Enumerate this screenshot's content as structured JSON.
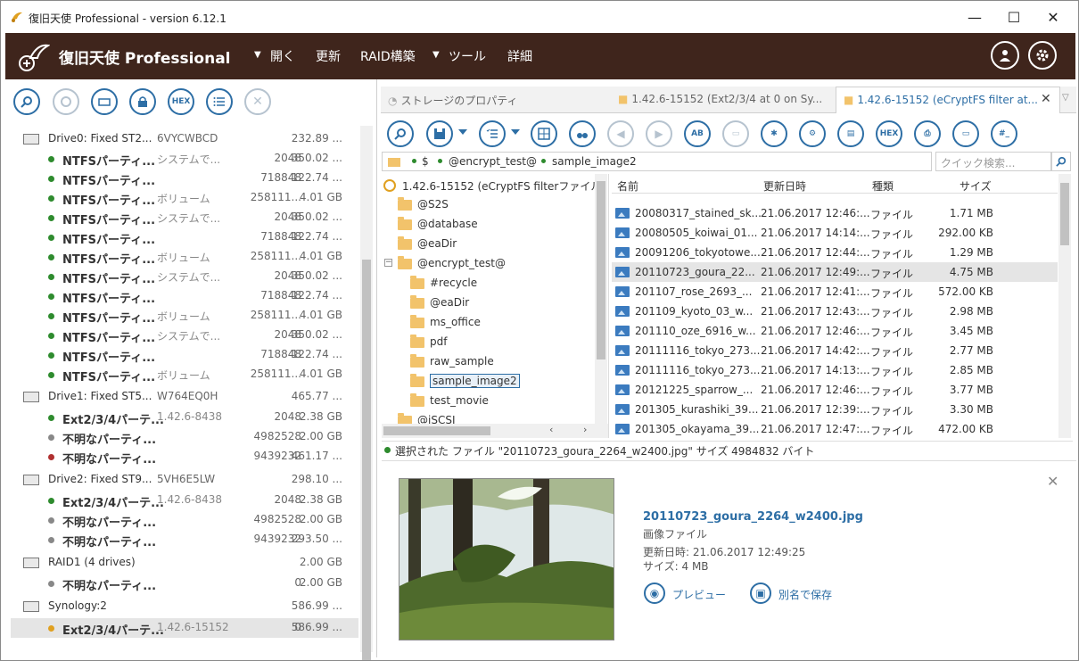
{
  "window": {
    "title": "復旧天使 Professional - version 6.12.1",
    "minimize": "—",
    "maximize": "☐",
    "close": "✕"
  },
  "menubar": {
    "brand": "復旧天使 Professional",
    "items": [
      "開く",
      "更新",
      "RAID構築",
      "ツール",
      "詳細"
    ],
    "accent": "#3f251c"
  },
  "left_toolbar": {
    "hex_label": "HEX"
  },
  "drives": [
    {
      "name": "Drive0: Fixed ST2...",
      "serial": "6VYCWBCD",
      "size": "232.89 ..."
    },
    {
      "name": "Drive1: Fixed ST5...",
      "serial": "W764EQ0H",
      "size": "465.77 ..."
    },
    {
      "name": "Drive2: Fixed ST9...",
      "serial": "5VH6E5LW",
      "size": "298.10 ..."
    },
    {
      "name": "RAID1 (4 drives)",
      "serial": "",
      "size": "2.00 GB"
    },
    {
      "name": "Synology:2",
      "serial": "",
      "size": "586.99 ..."
    }
  ],
  "partitions": [
    {
      "name": "NTFSパーティ...",
      "label": "システムで...",
      "start": "2048",
      "size": "350.02 ...",
      "color": "#2e8b2e"
    },
    {
      "name": "NTFSパーティ...",
      "label": "",
      "start": "718848",
      "size": "122.74 ...",
      "color": "#2e8b2e"
    },
    {
      "name": "NTFSパーティ...",
      "label": "ボリューム",
      "start": "258111...",
      "size": "4.01 GB",
      "color": "#2e8b2e"
    },
    {
      "name": "NTFSパーティ...",
      "label": "システムで...",
      "start": "2048",
      "size": "350.02 ...",
      "color": "#2e8b2e"
    },
    {
      "name": "NTFSパーティ...",
      "label": "",
      "start": "718848",
      "size": "122.74 ...",
      "color": "#2e8b2e"
    },
    {
      "name": "NTFSパーティ...",
      "label": "ボリューム",
      "start": "258111...",
      "size": "4.01 GB",
      "color": "#2e8b2e"
    },
    {
      "name": "NTFSパーティ...",
      "label": "システムで...",
      "start": "2048",
      "size": "350.02 ...",
      "color": "#2e8b2e"
    },
    {
      "name": "NTFSパーティ...",
      "label": "",
      "start": "718848",
      "size": "122.74 ...",
      "color": "#2e8b2e"
    },
    {
      "name": "NTFSパーティ...",
      "label": "ボリューム",
      "start": "258111...",
      "size": "4.01 GB",
      "color": "#2e8b2e"
    },
    {
      "name": "NTFSパーティ...",
      "label": "システムで...",
      "start": "2048",
      "size": "350.02 ...",
      "color": "#2e8b2e"
    },
    {
      "name": "NTFSパーティ...",
      "label": "",
      "start": "718848",
      "size": "122.74 ...",
      "color": "#2e8b2e"
    },
    {
      "name": "NTFSパーティ...",
      "label": "ボリューム",
      "start": "258111...",
      "size": "4.01 GB",
      "color": "#2e8b2e"
    },
    {
      "name": "Ext2/3/4パーテ...",
      "label": "1.42.6-8438",
      "start": "2048",
      "size": "2.38 GB",
      "color": "#2e8b2e"
    },
    {
      "name": "不明なパーティ...",
      "label": "",
      "start": "4982528",
      "size": "2.00 GB",
      "color": "#888888"
    },
    {
      "name": "不明なパーティ...",
      "label": "",
      "start": "9439232",
      "size": "461.17 ...",
      "color": "#b03030"
    },
    {
      "name": "Ext2/3/4パーテ...",
      "label": "1.42.6-8438",
      "start": "2048",
      "size": "2.38 GB",
      "color": "#2e8b2e"
    },
    {
      "name": "不明なパーティ...",
      "label": "",
      "start": "4982528",
      "size": "2.00 GB",
      "color": "#888888"
    },
    {
      "name": "不明なパーティ...",
      "label": "",
      "start": "9439232",
      "size": "293.50 ...",
      "color": "#888888"
    },
    {
      "name": "不明なパーティ...",
      "label": "",
      "start": "0",
      "size": "2.00 GB",
      "color": "#888888"
    },
    {
      "name": "Ext2/3/4パーテ...",
      "label": "1.42.6-15152",
      "start": "0",
      "size": "586.99 ...",
      "color": "#e0a020"
    }
  ],
  "tabs": [
    "ストレージのプロパティ",
    "1.42.6-15152 (Ext2/3/4 at 0 on Sy...",
    "1.42.6-15152 (eCryptFS filter at..."
  ],
  "right_toolbar": {
    "hex_label": "HEX",
    "text_label": "AB",
    "hash_label": "#_"
  },
  "path": {
    "root": "$",
    "segments": [
      "@encrypt_test@",
      "sample_image2"
    ]
  },
  "search": {
    "placeholder": "クイック検索..."
  },
  "tree": {
    "root": "1.42.6-15152 (eCryptFS filterファイル",
    "items": [
      "@S2S",
      "@database",
      "@eaDir",
      "@encrypt_test@",
      "#recycle",
      "@eaDir",
      "ms_office",
      "pdf",
      "raw_sample",
      "sample_image2",
      "test_movie",
      "@iSCSI"
    ]
  },
  "filelist": {
    "headers": [
      "名前",
      "更新日時",
      "種類",
      "サイズ"
    ],
    "rows": [
      {
        "name": "20080317_stained_sk...",
        "date": "21.06.2017 12:46:...",
        "type": "ファイル",
        "size": "1.71 MB"
      },
      {
        "name": "20080505_koiwai_01...",
        "date": "21.06.2017 14:14:...",
        "type": "ファイル",
        "size": "292.00 KB"
      },
      {
        "name": "20091206_tokyotowe...",
        "date": "21.06.2017 12:44:...",
        "type": "ファイル",
        "size": "1.29 MB"
      },
      {
        "name": "20110723_goura_22...",
        "date": "21.06.2017 12:49:...",
        "type": "ファイル",
        "size": "4.75 MB"
      },
      {
        "name": "201107_rose_2693_...",
        "date": "21.06.2017 12:41:...",
        "type": "ファイル",
        "size": "572.00 KB"
      },
      {
        "name": "201109_kyoto_03_w...",
        "date": "21.06.2017 12:43:...",
        "type": "ファイル",
        "size": "2.98 MB"
      },
      {
        "name": "201110_oze_6916_w...",
        "date": "21.06.2017 12:46:...",
        "type": "ファイル",
        "size": "3.45 MB"
      },
      {
        "name": "20111116_tokyo_273...",
        "date": "21.06.2017 14:42:...",
        "type": "ファイル",
        "size": "2.77 MB"
      },
      {
        "name": "20111116_tokyo_273...",
        "date": "21.06.2017 14:13:...",
        "type": "ファイル",
        "size": "2.85 MB"
      },
      {
        "name": "20121225_sparrow_...",
        "date": "21.06.2017 12:46:...",
        "type": "ファイル",
        "size": "3.77 MB"
      },
      {
        "name": "201305_kurashiki_39...",
        "date": "21.06.2017 12:39:...",
        "type": "ファイル",
        "size": "3.30 MB"
      },
      {
        "name": "201305_okayama_39...",
        "date": "21.06.2017 12:47:...",
        "type": "ファイル",
        "size": "472.00 KB"
      }
    ]
  },
  "status": {
    "text": "選択された ファイル \"20110723_goura_2264_w2400.jpg\" サイズ 4984832 バイト"
  },
  "preview": {
    "filename": "20110723_goura_2264_w2400.jpg",
    "type": "画像ファイル",
    "date": "更新日時: 21.06.2017 12:49:25",
    "size": "サイズ: 4 MB",
    "preview_label": "プレビュー",
    "save_label": "別名で保存"
  }
}
